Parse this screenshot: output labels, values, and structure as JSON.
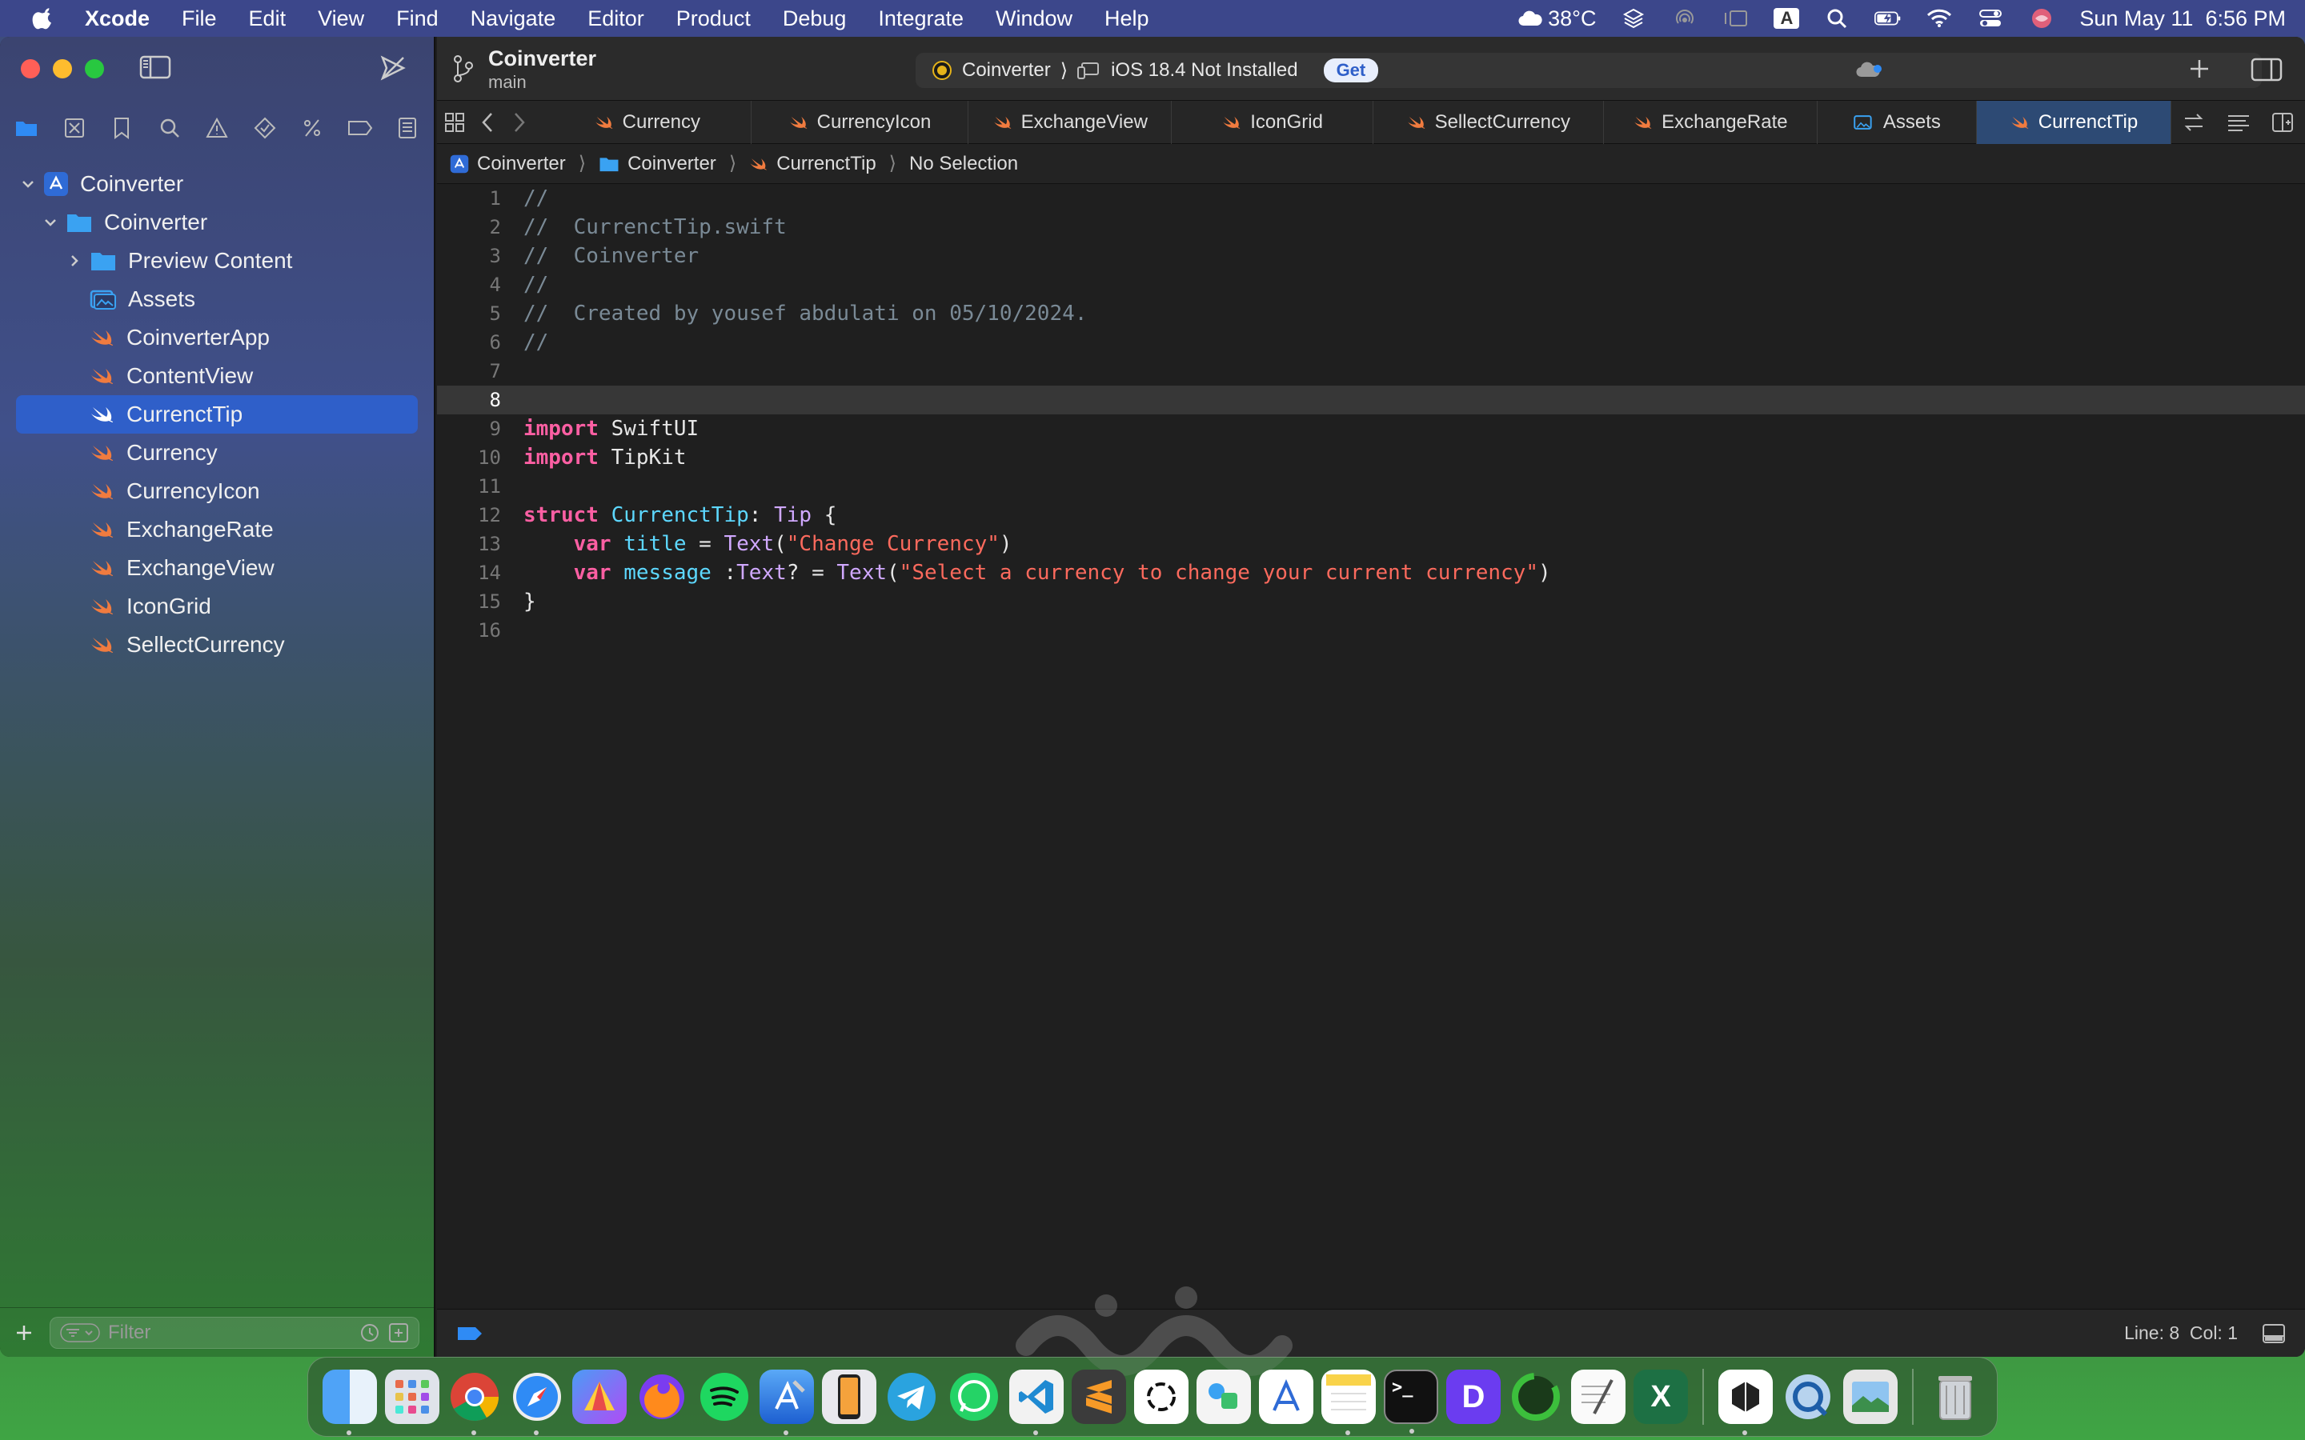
{
  "menubar": {
    "app": "Xcode",
    "items": [
      "File",
      "Edit",
      "View",
      "Find",
      "Navigate",
      "Editor",
      "Product",
      "Debug",
      "Integrate",
      "Window",
      "Help"
    ],
    "weather": "38°C",
    "input_source": "A",
    "datetime": "Sun May 11  6:56 PM"
  },
  "toolbar": {
    "project": "Coinverter",
    "branch": "main",
    "scheme": "Coinverter",
    "destination": "iOS 18.4 Not Installed",
    "get_label": "Get"
  },
  "tabs": [
    {
      "label": "Currency",
      "icon": "swift-icon",
      "active": false
    },
    {
      "label": "CurrencyIcon",
      "icon": "swift-icon",
      "active": false
    },
    {
      "label": "ExchangeView",
      "icon": "swift-icon",
      "active": false
    },
    {
      "label": "IconGrid",
      "icon": "swift-icon",
      "active": false
    },
    {
      "label": "SellectCurrency",
      "icon": "swift-icon",
      "active": false
    },
    {
      "label": "ExchangeRate",
      "icon": "swift-icon",
      "active": false
    },
    {
      "label": "Assets",
      "icon": "assets-icon",
      "active": false
    },
    {
      "label": "CurrenctTip",
      "icon": "swift-icon",
      "active": true
    }
  ],
  "jumpbar": {
    "project": "Coinverter",
    "group": "Coinverter",
    "file": "CurrenctTip",
    "selection": "No Selection"
  },
  "navigator": {
    "project": "Coinverter",
    "group": "Coinverter",
    "items": [
      {
        "label": "Preview Content",
        "type": "folder"
      },
      {
        "label": "Assets",
        "type": "assets"
      },
      {
        "label": "CoinverterApp",
        "type": "swift"
      },
      {
        "label": "ContentView",
        "type": "swift"
      },
      {
        "label": "CurrenctTip",
        "type": "swift",
        "selected": true
      },
      {
        "label": "Currency",
        "type": "swift"
      },
      {
        "label": "CurrencyIcon",
        "type": "swift"
      },
      {
        "label": "ExchangeRate",
        "type": "swift"
      },
      {
        "label": "ExchangeView",
        "type": "swift"
      },
      {
        "label": "IconGrid",
        "type": "swift"
      },
      {
        "label": "SellectCurrency",
        "type": "swift"
      }
    ],
    "filter_placeholder": "Filter"
  },
  "code": {
    "lines": [
      "//",
      "//  CurrenctTip.swift",
      "//  Coinverter",
      "//",
      "//  Created by yousef abdulati on 05/10/2024.",
      "//",
      "",
      "",
      "import SwiftUI",
      "import TipKit",
      "",
      "struct CurrenctTip: Tip {",
      "    var title = Text(\"Change Currency\")",
      "    var message :Text? = Text(\"Select a currency to change your current currency\")",
      "}",
      ""
    ],
    "line_numbers": [
      "1",
      "2",
      "3",
      "4",
      "5",
      "6",
      "7",
      "8",
      "9",
      "10",
      "11",
      "12",
      "13",
      "14",
      "15",
      "16"
    ],
    "current_line": 8
  },
  "status": {
    "cursor": "Line: 8  Col: 1"
  },
  "dock": {
    "apps": [
      "Finder",
      "Launchpad",
      "Chrome",
      "Safari",
      "Affinity",
      "Firefox",
      "Spotify",
      "Xcode",
      "Simulator",
      "Telegram",
      "WhatsApp",
      "VS Code",
      "Sublime",
      "ChatGPT",
      "Freeform",
      "Creator",
      "Notes",
      "Terminal",
      "Dia",
      "Circle",
      "TextEdit",
      "Excel",
      "Mirror",
      "QuickTime",
      "Preview",
      "Trash"
    ]
  },
  "colors": {
    "accent": "#2f5fc9",
    "swift_orange": "#f07b3f",
    "keyword": "#fc5fa3",
    "string": "#fc6a5d",
    "type": "#5dd8ff",
    "comment": "#7a8a96"
  }
}
